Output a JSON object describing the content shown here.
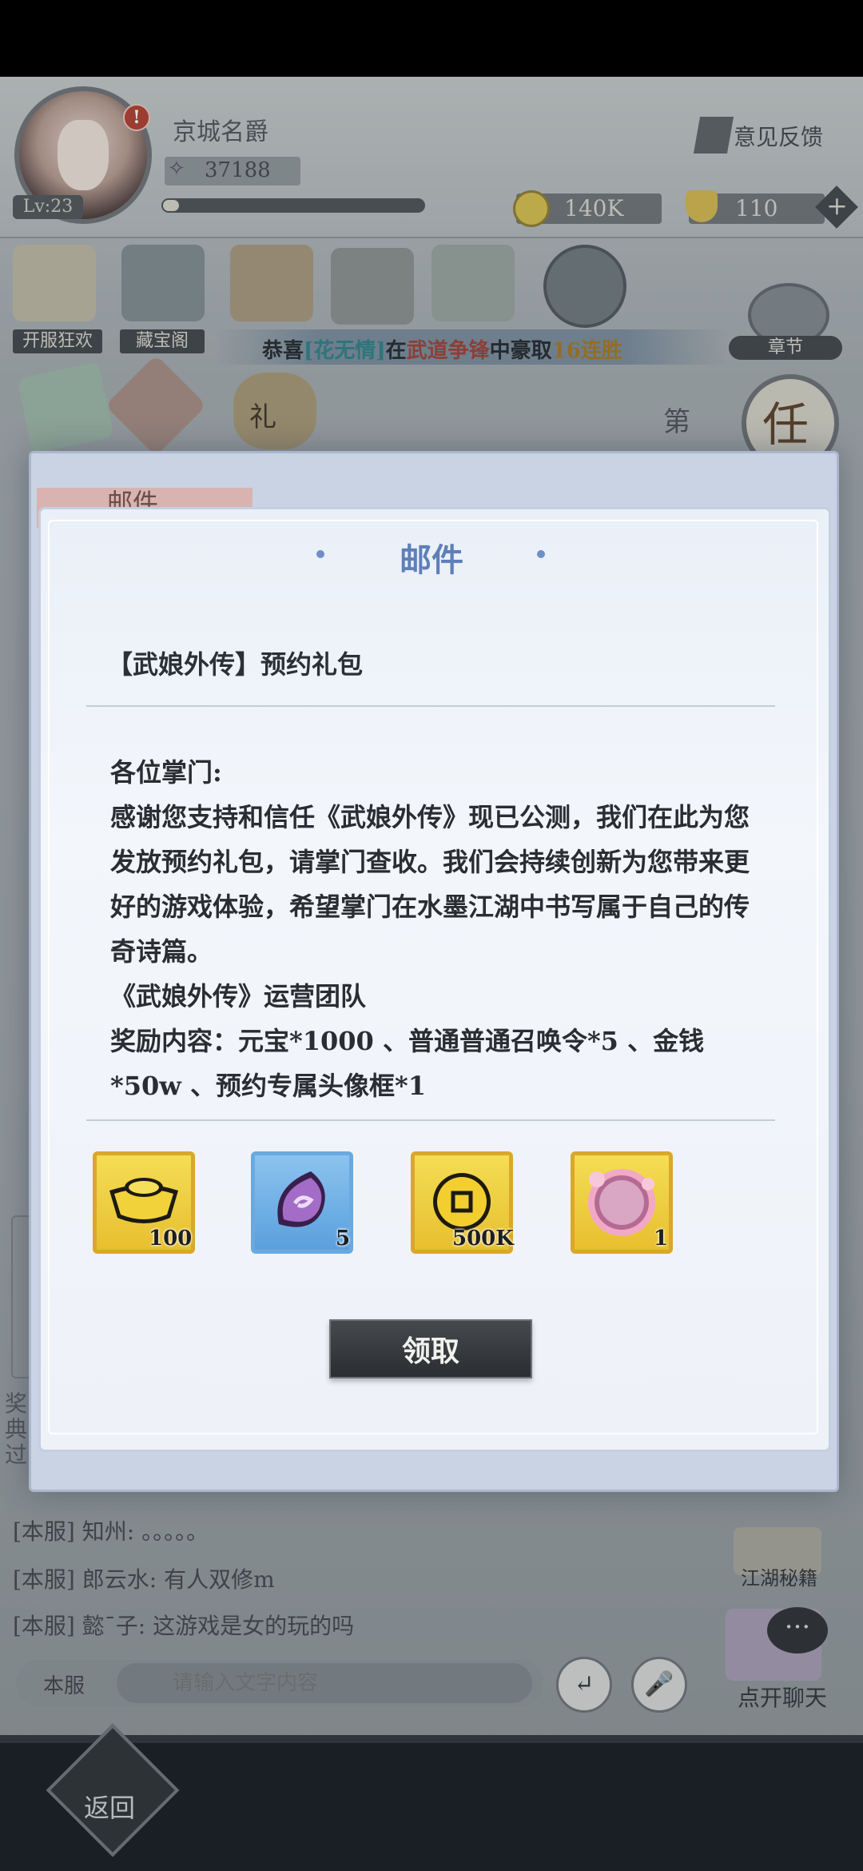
{
  "player": {
    "name": "京城名爵",
    "level": "Lv:23",
    "power": "37188",
    "exp_progress": 0.06
  },
  "header": {
    "feedback_label": "意见反馈",
    "coins": "140K",
    "ingots": "110"
  },
  "menu": {
    "items": [
      {
        "label": "开服狂欢",
        "icon": "scroll-icon"
      },
      {
        "label": "藏宝阁",
        "icon": "pavilion-icon"
      },
      {
        "label": "",
        "icon": "gift-box-icon"
      },
      {
        "label": "",
        "icon": "yin-yang-icon"
      },
      {
        "label": "",
        "icon": "map-icon"
      },
      {
        "label": "",
        "icon": "compass-icon"
      }
    ],
    "row2": [
      {
        "icon": "talisman-icon"
      },
      {
        "icon": "character-portrait-icon"
      },
      {
        "icon": "gift-bag-icon",
        "text": "礼"
      }
    ],
    "chapter_label": "章节",
    "task_glyph": "任",
    "side_char": "第"
  },
  "marquee": {
    "prefix": "恭喜",
    "player": "[花无情]",
    "mid": "在",
    "event": "武道争锋",
    "mid2": "中豪取",
    "result": "16连胜"
  },
  "dialog_back_title": "邮件",
  "mail": {
    "heading": "邮件",
    "subject": "【武娘外传】预约礼包",
    "body": [
      "各位掌门:",
      "感谢您支持和信任《武娘外传》现已公测，我们在此为您发放预约礼包，请掌门查收。我们会持续创新为您带来更好的游戏体验，希望掌门在水墨江湖中书写属于自己的传奇诗篇。",
      "《武娘外传》运营团队",
      "奖励内容：元宝*1000 、普通普通召唤令*5 、金钱*50w 、预约专属头像框*1"
    ],
    "rewards": [
      {
        "icon": "gold-ingot-icon",
        "count": "100",
        "style": "gold"
      },
      {
        "icon": "summon-token-icon",
        "count": "5",
        "style": "blue"
      },
      {
        "icon": "coin-icon",
        "count": "500K",
        "style": "gold"
      },
      {
        "icon": "avatar-frame-icon",
        "count": "1",
        "style": "gold"
      }
    ],
    "claim_label": "领取"
  },
  "left_side_text": "奖典过",
  "chat": {
    "lines": [
      "[本服] 知州: 。。。。。",
      "[本服] 郎云水: 有人双修m",
      "[本服] 懿ˉ子: 这游戏是女的玩的吗"
    ],
    "channel": "本服",
    "input_placeholder": "请输入文字内容",
    "secrets_label": "江湖秘籍",
    "open_chat_label": "点开聊天",
    "bubble": "···"
  },
  "nav": {
    "back_label": "返回"
  }
}
